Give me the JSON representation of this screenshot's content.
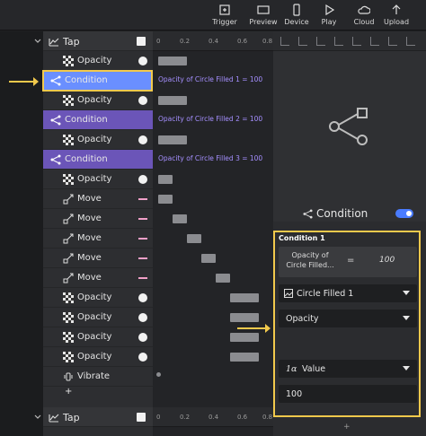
{
  "toolbar": {
    "items": [
      {
        "label": "Trigger",
        "icon": "trigger-icon"
      },
      {
        "label": "Preview",
        "icon": "preview-icon"
      },
      {
        "label": "Device",
        "icon": "device-icon"
      },
      {
        "label": "Play",
        "icon": "play-icon"
      },
      {
        "label": "Cloud",
        "icon": "cloud-icon"
      },
      {
        "label": "Upload",
        "icon": "upload-icon"
      }
    ]
  },
  "layers": {
    "top_header": "Tap",
    "rows": [
      {
        "label": "Opacity",
        "type": "opacity",
        "marker": "dot"
      },
      {
        "label": "Condition",
        "type": "condition-selected",
        "marker": ""
      },
      {
        "label": "Opacity",
        "type": "opacity",
        "marker": "dot"
      },
      {
        "label": "Condition",
        "type": "condition",
        "marker": ""
      },
      {
        "label": "Opacity",
        "type": "opacity",
        "marker": "dot"
      },
      {
        "label": "Condition",
        "type": "condition",
        "marker": ""
      },
      {
        "label": "Opacity",
        "type": "opacity",
        "marker": "dot"
      },
      {
        "label": "Move",
        "type": "move",
        "marker": "dash"
      },
      {
        "label": "Move",
        "type": "move",
        "marker": "dash"
      },
      {
        "label": "Move",
        "type": "move",
        "marker": "dash"
      },
      {
        "label": "Move",
        "type": "move",
        "marker": "dash"
      },
      {
        "label": "Move",
        "type": "move",
        "marker": "dash"
      },
      {
        "label": "Opacity",
        "type": "opacity",
        "marker": "dot"
      },
      {
        "label": "Opacity",
        "type": "opacity",
        "marker": "dot"
      },
      {
        "label": "Opacity",
        "type": "opacity",
        "marker": "dot"
      },
      {
        "label": "Opacity",
        "type": "opacity",
        "marker": "dot"
      },
      {
        "label": "Vibrate",
        "type": "vibrate",
        "marker": ""
      }
    ],
    "add_label": "+",
    "bottom_header": "Tap"
  },
  "timeline": {
    "ticks": [
      "0",
      "0.2",
      "0.4",
      "0.6",
      "0.8"
    ],
    "bottom_ticks": [
      "0",
      "0.2",
      "0.4",
      "0.6",
      "0.8"
    ],
    "conditions": [
      "Opacity of Circle Filled 1 = 100",
      "Opacity of Circle Filled 2 = 100",
      "Opacity of Circle Filled 3 = 100"
    ],
    "bar_starts": [
      0,
      null,
      0,
      null,
      0,
      null,
      0,
      0,
      0.1,
      0.2,
      0.3,
      0.4,
      0.5,
      0.5,
      0.5,
      0.5
    ],
    "bar_lengths": [
      0.2,
      null,
      0.2,
      null,
      0.2,
      null,
      0.1,
      0.1,
      0.1,
      0.1,
      0.1,
      0.1,
      0.2,
      0.2,
      0.2,
      0.2
    ]
  },
  "right_panel": {
    "title": "Condition",
    "title_icon": "condition-icon",
    "toggle_on": true,
    "condition_heading": "Condition 1",
    "property_label": "Opacity of Circle Filled...",
    "equals_sign": "=",
    "value": "100",
    "layer_select": "Circle Filled 1",
    "property_select": "Opacity",
    "operators": [
      ">",
      "≥",
      "<",
      "≤",
      "=",
      "≠"
    ],
    "active_operator": "=",
    "value_type": "Value",
    "value_input": "100",
    "add_label": "+"
  },
  "colors": {
    "condition": "#6b55b8",
    "selected": "#6a8fff",
    "highlight": "#f2c94c",
    "accent": "#3d7bff"
  }
}
